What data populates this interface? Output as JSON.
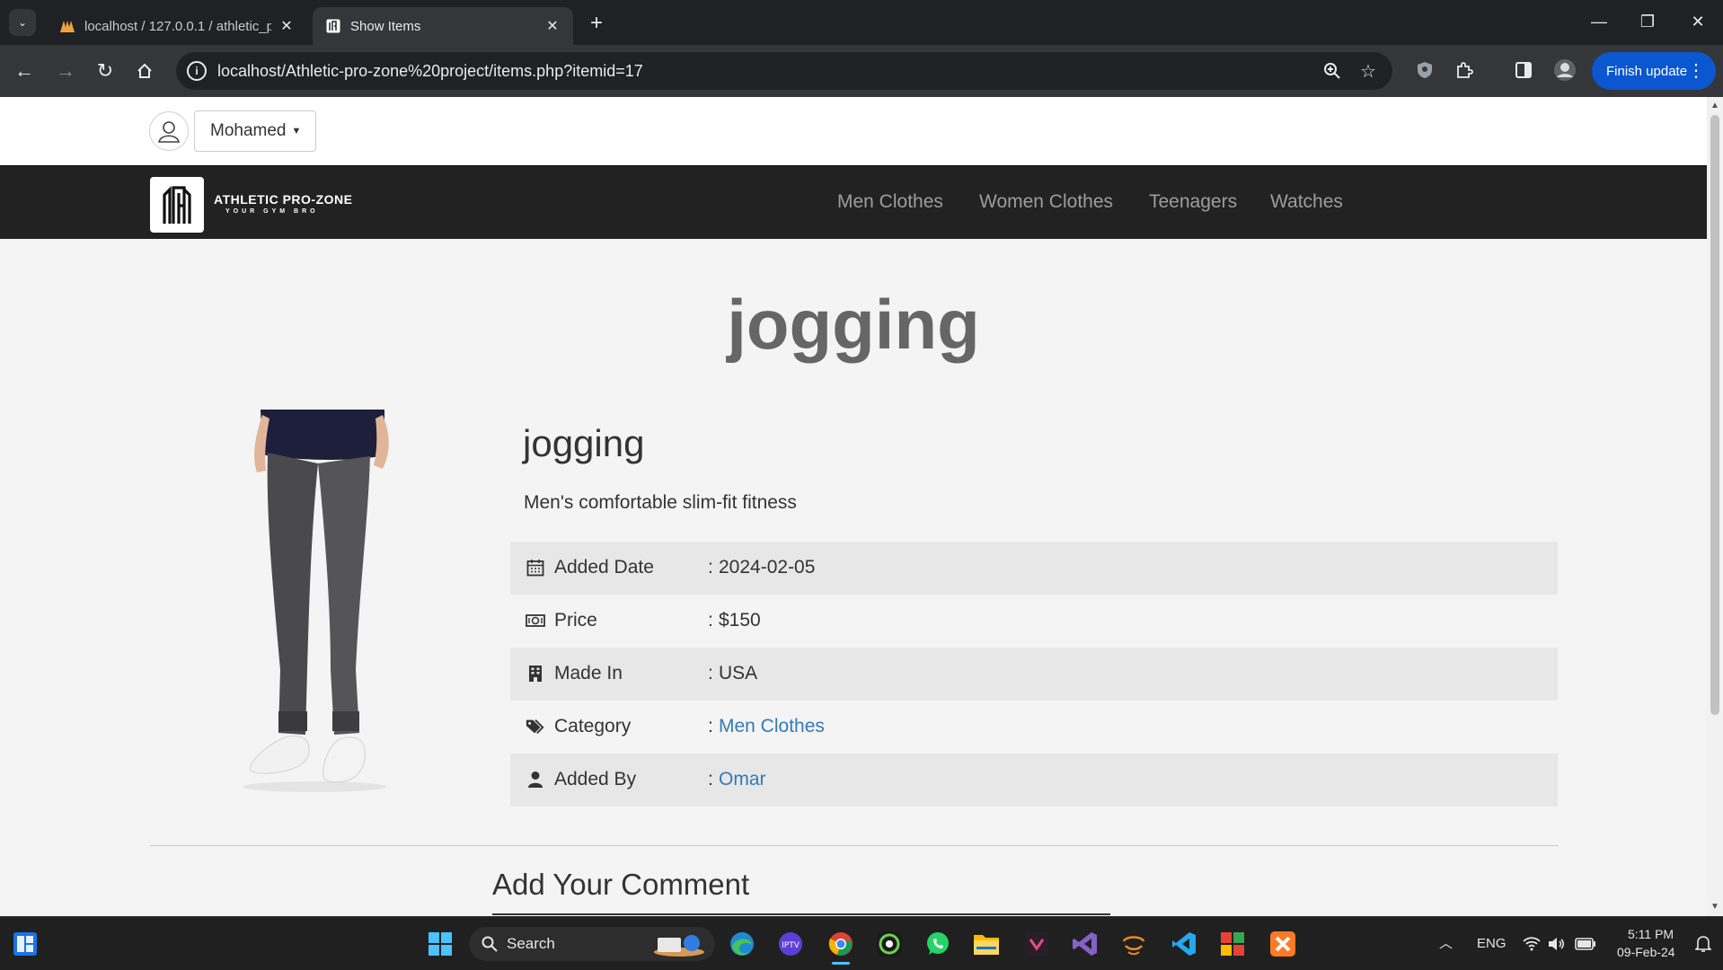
{
  "browser": {
    "tabs": [
      {
        "title": "localhost / 127.0.0.1 / athletic_p",
        "active": false
      },
      {
        "title": "Show Items",
        "active": true
      }
    ],
    "url": "localhost/Athletic-pro-zone%20project/items.php?itemid=17",
    "update_label": "Finish update",
    "accent": "#0b57d0"
  },
  "site": {
    "user_name": "Mohamed",
    "brand_name": "ATHLETIC PRO-ZONE",
    "brand_tagline": "YOUR GYM BRO",
    "nav": [
      "Men Clothes",
      "Women Clothes",
      "Teenagers",
      "Watches"
    ]
  },
  "item": {
    "heading": "jogging",
    "name": "jogging",
    "description": "Men's comfortable slim-fit fitness",
    "details": [
      {
        "icon": "calendar-icon",
        "label": "Added Date",
        "value": "2024-02-05"
      },
      {
        "icon": "money-icon",
        "label": "Price",
        "value": "$150"
      },
      {
        "icon": "building-icon",
        "label": "Made In",
        "value": "USA"
      },
      {
        "icon": "tags-icon",
        "label": "Category",
        "value": "Men Clothes"
      },
      {
        "icon": "user-icon",
        "label": "Added By",
        "value": "Omar"
      }
    ],
    "link_color": "#337ab7"
  },
  "comments": {
    "heading": "Add Your Comment"
  },
  "taskbar": {
    "search_label": "Search",
    "language": "ENG",
    "time": "5:11 PM",
    "date": "09-Feb-24"
  }
}
